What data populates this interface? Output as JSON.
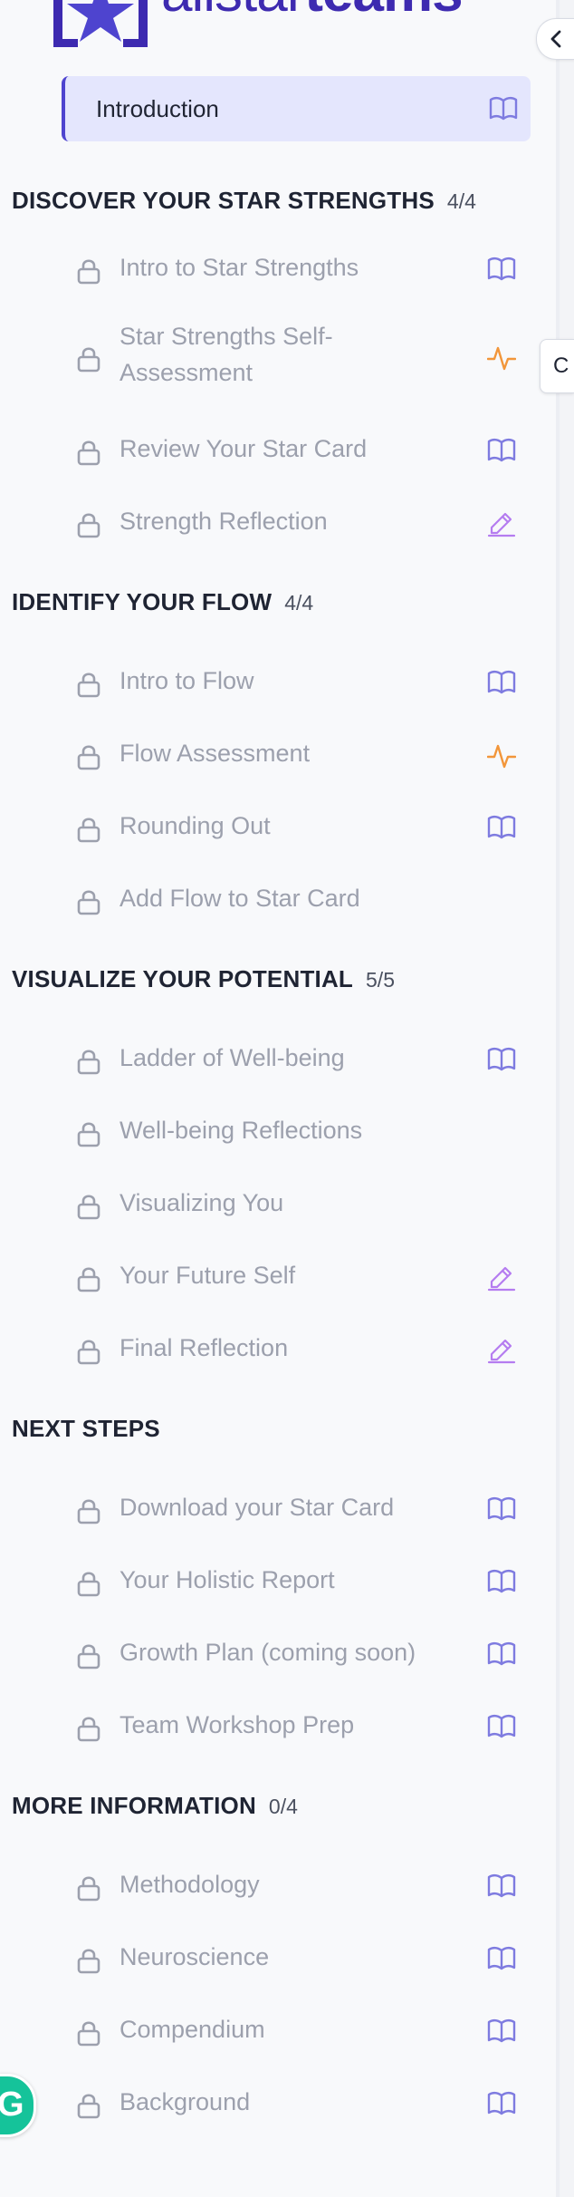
{
  "brand": {
    "logo_text_part1": "allstar",
    "logo_text_part2": "teams",
    "accent": "#3d2ab0"
  },
  "intro": {
    "label": "Introduction",
    "icon": "book-open-icon"
  },
  "side_tab_text": "C",
  "sections": [
    {
      "title": "DISCOVER YOUR STAR STRENGTHS",
      "count": "4/4",
      "items": [
        {
          "label": "Intro to Star Strengths",
          "icon": "book-open-icon"
        },
        {
          "label": "Star Strengths Self-Assessment",
          "icon": "activity-icon"
        },
        {
          "label": "Review Your Star Card",
          "icon": "book-open-icon"
        },
        {
          "label": "Strength Reflection",
          "icon": "pencil-icon"
        }
      ]
    },
    {
      "title": "IDENTIFY YOUR FLOW",
      "count": "4/4",
      "items": [
        {
          "label": "Intro to Flow",
          "icon": "book-open-icon"
        },
        {
          "label": "Flow Assessment",
          "icon": "activity-icon"
        },
        {
          "label": "Rounding Out",
          "icon": "book-open-icon"
        },
        {
          "label": "Add Flow to Star Card",
          "icon": ""
        }
      ]
    },
    {
      "title": "VISUALIZE YOUR POTENTIAL",
      "count": "5/5",
      "items": [
        {
          "label": "Ladder of Well-being",
          "icon": "book-open-icon"
        },
        {
          "label": "Well-being Reflections",
          "icon": ""
        },
        {
          "label": "Visualizing You",
          "icon": ""
        },
        {
          "label": "Your Future Self",
          "icon": "pencil-icon"
        },
        {
          "label": "Final Reflection",
          "icon": "pencil-icon"
        }
      ]
    },
    {
      "title": "NEXT STEPS",
      "count": "",
      "items": [
        {
          "label": "Download your Star Card",
          "icon": "book-open-icon"
        },
        {
          "label": "Your Holistic Report",
          "icon": "book-open-icon"
        },
        {
          "label": "Growth Plan (coming soon)",
          "icon": "book-open-icon"
        },
        {
          "label": "Team Workshop Prep",
          "icon": "book-open-icon"
        }
      ]
    },
    {
      "title": "MORE INFORMATION",
      "count": "0/4",
      "items": [
        {
          "label": "Methodology",
          "icon": "book-open-icon"
        },
        {
          "label": "Neuroscience",
          "icon": "book-open-icon"
        },
        {
          "label": "Compendium",
          "icon": "book-open-icon"
        },
        {
          "label": "Background",
          "icon": "book-open-icon"
        }
      ]
    }
  ],
  "grammarly_badge": "G",
  "colors": {
    "book": "#7e7be0",
    "activity": "#f2963a",
    "pencil": "#b57cf0",
    "lock": "#9ca0ad",
    "intro_bg": "#e4e6fd",
    "intro_border": "#4e44cf"
  }
}
